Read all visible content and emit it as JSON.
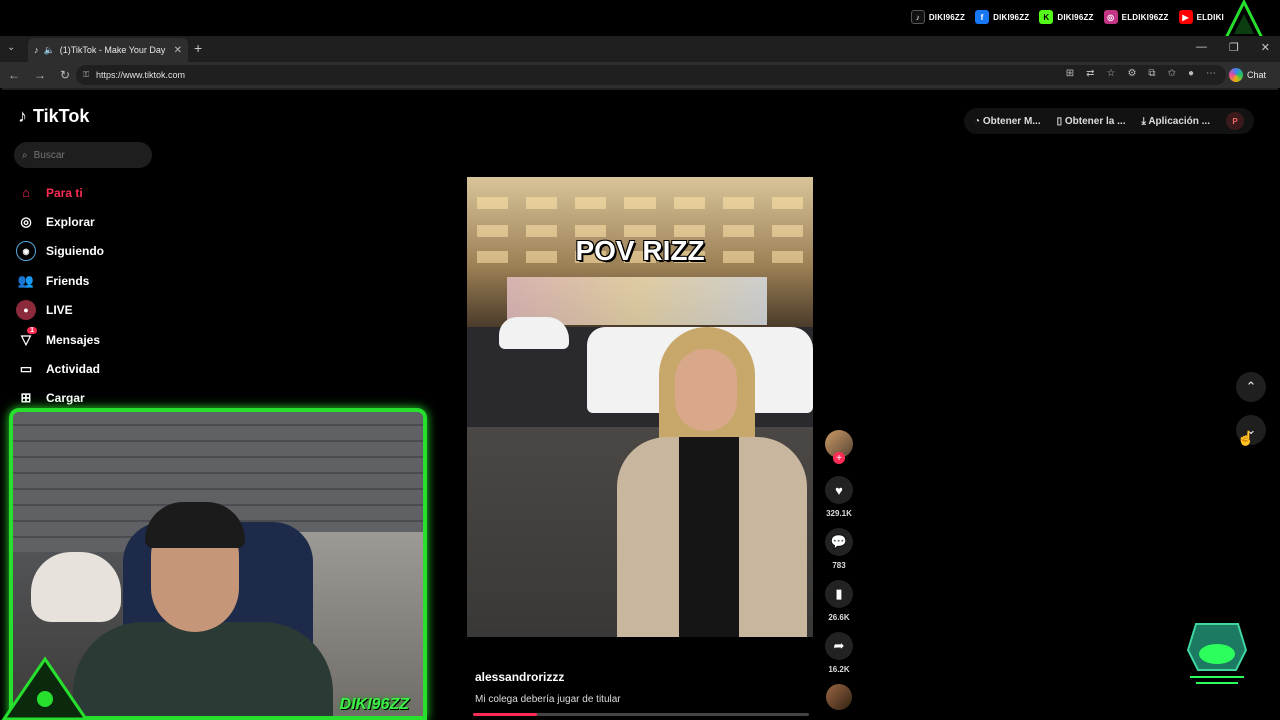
{
  "overlay": {
    "socials": [
      {
        "icon": "tiktok-icon",
        "label": "DIKI96ZZ",
        "color": "#111111"
      },
      {
        "icon": "facebook-icon",
        "label": "DIKI96ZZ",
        "color": "#1877f2"
      },
      {
        "icon": "kick-icon",
        "label": "DIKI96ZZ",
        "color": "#53fc18"
      },
      {
        "icon": "instagram-icon",
        "label": "ELDIKI96ZZ",
        "color": "#c13584"
      },
      {
        "icon": "youtube-icon",
        "label": "ELDIKI",
        "color": "#ff0000"
      }
    ],
    "cam_label": "DIKI96ZZ",
    "accent": "#27e02d"
  },
  "browser": {
    "tab_title": "(1)TikTok - Make Your Day",
    "url": "https://www.tiktok.com",
    "chat_label": "Chat"
  },
  "tiktok": {
    "logo_text": "TikTok",
    "search_placeholder": "Buscar",
    "menu": [
      {
        "label": "Para ti",
        "icon": "home-icon",
        "active": true
      },
      {
        "label": "Explorar",
        "icon": "compass-icon"
      },
      {
        "label": "Siguiendo",
        "icon": "following-icon"
      },
      {
        "label": "Friends",
        "icon": "friends-icon"
      },
      {
        "label": "LIVE",
        "icon": "live-icon"
      },
      {
        "label": "Mensajes",
        "icon": "messages-icon",
        "badge": "1"
      },
      {
        "label": "Actividad",
        "icon": "activity-icon"
      },
      {
        "label": "Cargar",
        "icon": "upload-icon"
      }
    ],
    "top_buttons": [
      "Obtener M...",
      "Obtener la ...",
      "Aplicación ..."
    ],
    "profile_initial": "P",
    "brand_color": "#fe2c55"
  },
  "video": {
    "overlay_text": "POV RIZZ",
    "username": "alessandrorizzz",
    "caption": "Mi colega debería jugar de titular",
    "progress": 0.19,
    "likes": "329.1K",
    "comments": "783",
    "saves": "26.6K",
    "shares": "16.2K"
  }
}
